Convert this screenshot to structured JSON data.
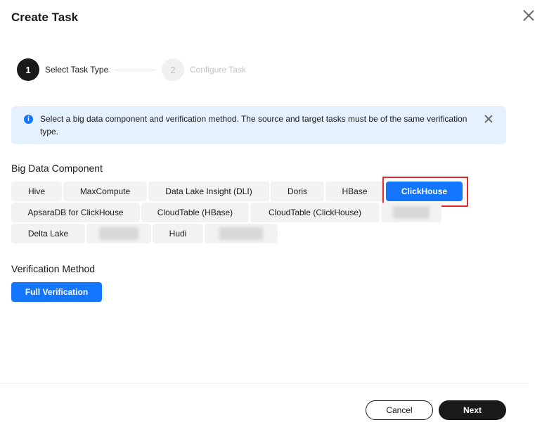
{
  "dialog": {
    "title": "Create Task"
  },
  "steps": [
    {
      "number": "1",
      "label": "Select Task Type",
      "state": "active"
    },
    {
      "number": "2",
      "label": "Configure Task",
      "state": "inactive"
    }
  ],
  "alert": {
    "icon": "info-icon",
    "icon_glyph": "i",
    "text": "Select a big data component and verification method. The source and target tasks must be of the same verification type."
  },
  "big_data_component": {
    "label": "Big Data Component",
    "options": [
      "Hive",
      "MaxCompute",
      "Data Lake Insight (DLI)",
      "Doris",
      "HBase",
      "ClickHouse",
      "ApsaraDB for ClickHouse",
      "CloudTable (HBase)",
      "CloudTable (ClickHouse)",
      "",
      "Delta Lake",
      "",
      "Hudi",
      ""
    ],
    "selected": "ClickHouse"
  },
  "verification_method": {
    "label": "Verification Method",
    "selected": "Full Verification"
  },
  "footer": {
    "cancel_label": "Cancel",
    "next_label": "Next"
  },
  "colors": {
    "accent": "#1476ff",
    "alert_bg": "#e6f1ff",
    "highlight": "#e8262b",
    "dark": "#191919"
  }
}
